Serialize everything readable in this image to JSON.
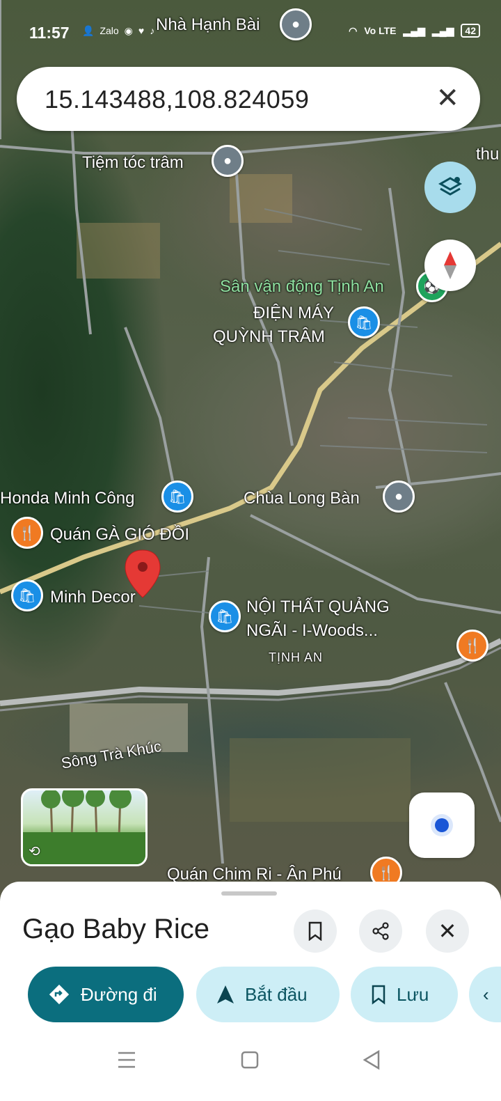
{
  "status_bar": {
    "time": "11:57",
    "network": "Vo LTE",
    "battery": "42"
  },
  "search": {
    "query": "15.143488,108.824059"
  },
  "map": {
    "labels": {
      "nha_hanh_bai": "Nhà Hạnh Bài",
      "tiem_toc_tram": "Tiệm tóc trâm",
      "thu_partial": "thu",
      "san_van_dong": "Sân vận động Tịnh An",
      "dien_may_line1": "ĐIỆN MÁY",
      "dien_may_line2": "QUỲNH TRÂM",
      "honda": "Honda Minh Công",
      "chua_long_ban": "Chùa Long Bàn",
      "quan_ga": "Quán GÀ GIÓ ĐỒI",
      "minh_decor": "Minh Decor",
      "noi_that_line1": "NỘI THẤT QUẢNG",
      "noi_that_line2": "NGÃI - I-Woods...",
      "tinh_an": "TỊNH AN",
      "song_tra_khuc": "Sông Trà Khúc",
      "quan_chim": "Quán Chim Ri - Ân Phú"
    }
  },
  "place": {
    "name": "Gạo Baby Rice"
  },
  "actions": {
    "directions": "Đường đi",
    "start": "Bắt đầu",
    "save": "Lưu"
  }
}
